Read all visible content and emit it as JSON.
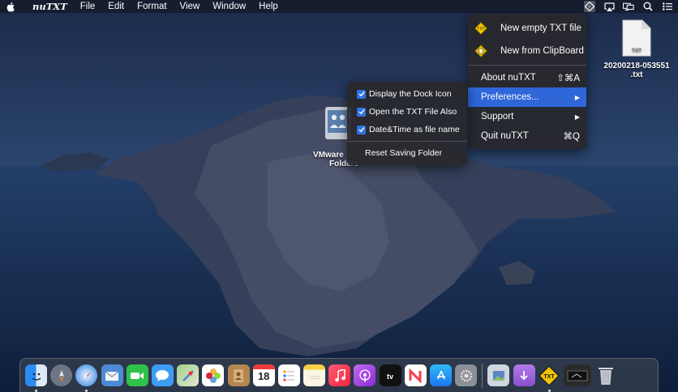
{
  "menubar": {
    "app_name": "nuTXT",
    "items": [
      "File",
      "Edit",
      "Format",
      "View",
      "Window",
      "Help"
    ],
    "status_icons": [
      "nutxt-status-icon",
      "airplay-icon",
      "display-icon",
      "search-icon",
      "list-icon"
    ]
  },
  "status_menu": {
    "items": [
      {
        "label": "New empty TXT file",
        "icon": "txt-diamond-icon"
      },
      {
        "label": "New from ClipBoard",
        "icon": "clipboard-diamond-icon"
      },
      {
        "label": "About nuTXT",
        "shortcut": "⇧⌘A"
      },
      {
        "label": "Preferences...",
        "submenu_arrow": "▶",
        "highlighted": true
      },
      {
        "label": "Support",
        "submenu_arrow": "▶"
      },
      {
        "label": "Quit nuTXT",
        "shortcut": "⌘Q"
      }
    ]
  },
  "preferences_submenu": {
    "items": [
      {
        "label": "Display the Dock Icon",
        "checked": true
      },
      {
        "label": "Open the TXT File Also",
        "checked": true
      },
      {
        "label": "Date&Time as file name",
        "checked": true
      },
      {
        "label": "Reset Saving Folder",
        "checked": false
      }
    ]
  },
  "desktop": {
    "file_icon_label": "TXT",
    "file_name_line1": "20200218-053551",
    "file_name_line2": ".txt",
    "folder_name_line1": "VMware",
    "folder_name_line2": "Folders"
  },
  "dock": {
    "txt_badge": "TXT",
    "calendar_day": "18",
    "apps": [
      "finder-icon",
      "launchpad-icon",
      "safari-icon",
      "mail-icon",
      "facetime-icon",
      "messages-icon",
      "maps-icon",
      "photos-icon",
      "contacts-icon",
      "calendar-icon",
      "reminders-icon",
      "notes-icon",
      "music-icon",
      "podcasts-icon",
      "tv-icon",
      "news-icon",
      "app-store-icon",
      "system-preferences-icon",
      "preview-icon",
      "downloads-folder-icon",
      "nutxt-icon",
      "screenshot-icon",
      "trash-icon"
    ]
  }
}
